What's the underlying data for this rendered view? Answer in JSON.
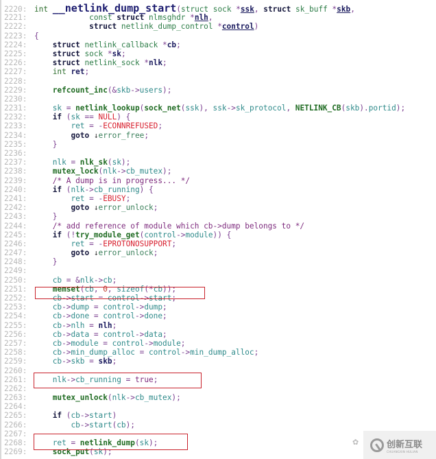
{
  "viewer": {
    "language": "C",
    "function_name": "__netlink_dump_start",
    "first_line": 2220,
    "last_line": 2269,
    "highlight_color": "#c8202a"
  },
  "lines": [
    {
      "n": "2220:",
      "tokens": [
        [
          "kwint",
          "int "
        ],
        [
          "fnbig",
          "__netlink_dump_start"
        ],
        [
          "punct",
          "("
        ],
        [
          "type",
          "struct sock "
        ],
        [
          "punct",
          "*"
        ],
        [
          "param",
          "ssk"
        ],
        [
          "punct",
          ", "
        ],
        [
          "kw",
          "struct "
        ],
        [
          "type",
          "sk_buff "
        ],
        [
          "punct",
          "*"
        ],
        [
          "param",
          "skb"
        ],
        [
          "punct",
          ","
        ]
      ]
    },
    {
      "n": "2221:",
      "tokens": [
        [
          "plain",
          "            "
        ],
        [
          "type",
          "const "
        ],
        [
          "kw",
          "struct "
        ],
        [
          "type",
          "nlmsghdr "
        ],
        [
          "punct",
          "*"
        ],
        [
          "param",
          "nlh"
        ],
        [
          "punct",
          ","
        ]
      ]
    },
    {
      "n": "2222:",
      "tokens": [
        [
          "plain",
          "            "
        ],
        [
          "kw",
          "struct "
        ],
        [
          "type",
          "netlink_dump_control "
        ],
        [
          "punct",
          "*"
        ],
        [
          "param",
          "control"
        ],
        [
          "punct",
          ")"
        ]
      ]
    },
    {
      "n": "2223:",
      "tokens": [
        [
          "punct",
          "{"
        ]
      ]
    },
    {
      "n": "2224:",
      "tokens": [
        [
          "plain",
          "    "
        ],
        [
          "kw",
          "struct "
        ],
        [
          "type",
          "netlink_callback "
        ],
        [
          "punct",
          "*"
        ],
        [
          "local",
          "cb"
        ],
        [
          "punct",
          ";"
        ]
      ]
    },
    {
      "n": "2225:",
      "tokens": [
        [
          "plain",
          "    "
        ],
        [
          "kw",
          "struct "
        ],
        [
          "type",
          "sock "
        ],
        [
          "punct",
          "*"
        ],
        [
          "local",
          "sk"
        ],
        [
          "punct",
          ";"
        ]
      ]
    },
    {
      "n": "2226:",
      "tokens": [
        [
          "plain",
          "    "
        ],
        [
          "kw",
          "struct "
        ],
        [
          "type",
          "netlink_sock "
        ],
        [
          "punct",
          "*"
        ],
        [
          "local",
          "nlk"
        ],
        [
          "punct",
          ";"
        ]
      ]
    },
    {
      "n": "2227:",
      "tokens": [
        [
          "plain",
          "    "
        ],
        [
          "kwint",
          "int "
        ],
        [
          "local",
          "ret"
        ],
        [
          "punct",
          ";"
        ]
      ]
    },
    {
      "n": "2228:",
      "tokens": []
    },
    {
      "n": "2229:",
      "tokens": [
        [
          "plain",
          "    "
        ],
        [
          "fn",
          "refcount_inc"
        ],
        [
          "punct",
          "(&"
        ],
        [
          "var",
          "skb"
        ],
        [
          "punct",
          "->"
        ],
        [
          "var",
          "users"
        ],
        [
          "punct",
          ");"
        ]
      ]
    },
    {
      "n": "2230:",
      "tokens": []
    },
    {
      "n": "2231:",
      "tokens": [
        [
          "plain",
          "    "
        ],
        [
          "var",
          "sk "
        ],
        [
          "punct",
          "= "
        ],
        [
          "fn",
          "netlink_lookup"
        ],
        [
          "punct",
          "("
        ],
        [
          "fn",
          "sock_net"
        ],
        [
          "punct",
          "("
        ],
        [
          "var",
          "ssk"
        ],
        [
          "punct",
          "), "
        ],
        [
          "var",
          "ssk"
        ],
        [
          "punct",
          "->"
        ],
        [
          "var",
          "sk_protocol"
        ],
        [
          "punct",
          ", "
        ],
        [
          "fn",
          "NETLINK_CB"
        ],
        [
          "punct",
          "("
        ],
        [
          "var",
          "skb"
        ],
        [
          "punct",
          ")."
        ],
        [
          "var",
          "portid"
        ],
        [
          "punct",
          ");"
        ]
      ]
    },
    {
      "n": "2232:",
      "tokens": [
        [
          "plain",
          "    "
        ],
        [
          "kw",
          "if "
        ],
        [
          "punct",
          "("
        ],
        [
          "var",
          "sk "
        ],
        [
          "punct",
          "== "
        ],
        [
          "const",
          "NULL"
        ],
        [
          "punct",
          ") {"
        ]
      ]
    },
    {
      "n": "2233:",
      "tokens": [
        [
          "plain",
          "        "
        ],
        [
          "var",
          "ret "
        ],
        [
          "punct",
          "= -"
        ],
        [
          "const",
          "ECONNREFUSED"
        ],
        [
          "punct",
          ";"
        ]
      ]
    },
    {
      "n": "2234:",
      "tokens": [
        [
          "plain",
          "        "
        ],
        [
          "kw",
          "goto "
        ],
        [
          "arrow",
          "↓"
        ],
        [
          "label",
          "error_free"
        ],
        [
          "punct",
          ";"
        ]
      ]
    },
    {
      "n": "2235:",
      "tokens": [
        [
          "plain",
          "    "
        ],
        [
          "punct",
          "}"
        ]
      ]
    },
    {
      "n": "2236:",
      "tokens": []
    },
    {
      "n": "2237:",
      "tokens": [
        [
          "plain",
          "    "
        ],
        [
          "var",
          "nlk "
        ],
        [
          "punct",
          "= "
        ],
        [
          "fn",
          "nlk_sk"
        ],
        [
          "punct",
          "("
        ],
        [
          "var",
          "sk"
        ],
        [
          "punct",
          ");"
        ]
      ]
    },
    {
      "n": "2238:",
      "tokens": [
        [
          "plain",
          "    "
        ],
        [
          "fn",
          "mutex_lock"
        ],
        [
          "punct",
          "("
        ],
        [
          "var",
          "nlk"
        ],
        [
          "punct",
          "->"
        ],
        [
          "var",
          "cb_mutex"
        ],
        [
          "punct",
          ");"
        ]
      ]
    },
    {
      "n": "2239:",
      "tokens": [
        [
          "plain",
          "    "
        ],
        [
          "comment",
          "/* A dump is in progress... */"
        ]
      ]
    },
    {
      "n": "2240:",
      "tokens": [
        [
          "plain",
          "    "
        ],
        [
          "kw",
          "if "
        ],
        [
          "punct",
          "("
        ],
        [
          "var",
          "nlk"
        ],
        [
          "punct",
          "->"
        ],
        [
          "var",
          "cb_running"
        ],
        [
          "punct",
          ") {"
        ]
      ]
    },
    {
      "n": "2241:",
      "tokens": [
        [
          "plain",
          "        "
        ],
        [
          "var",
          "ret "
        ],
        [
          "punct",
          "= -"
        ],
        [
          "const",
          "EBUSY"
        ],
        [
          "punct",
          ";"
        ]
      ]
    },
    {
      "n": "2242:",
      "tokens": [
        [
          "plain",
          "        "
        ],
        [
          "kw",
          "goto "
        ],
        [
          "arrow",
          "↓"
        ],
        [
          "label",
          "error_unlock"
        ],
        [
          "punct",
          ";"
        ]
      ]
    },
    {
      "n": "2243:",
      "tokens": [
        [
          "plain",
          "    "
        ],
        [
          "punct",
          "}"
        ]
      ]
    },
    {
      "n": "2244:",
      "tokens": [
        [
          "plain",
          "    "
        ],
        [
          "comment",
          "/* add reference of module which cb->dump belongs to */"
        ]
      ]
    },
    {
      "n": "2245:",
      "tokens": [
        [
          "plain",
          "    "
        ],
        [
          "kw",
          "if "
        ],
        [
          "punct",
          "(!"
        ],
        [
          "fn",
          "try_module_get"
        ],
        [
          "punct",
          "("
        ],
        [
          "var",
          "control"
        ],
        [
          "punct",
          "->"
        ],
        [
          "var",
          "module"
        ],
        [
          "punct",
          ")) {"
        ]
      ]
    },
    {
      "n": "2246:",
      "tokens": [
        [
          "plain",
          "        "
        ],
        [
          "var",
          "ret "
        ],
        [
          "punct",
          "= -"
        ],
        [
          "const",
          "EPROTONOSUPPORT"
        ],
        [
          "punct",
          ";"
        ]
      ]
    },
    {
      "n": "2247:",
      "tokens": [
        [
          "plain",
          "        "
        ],
        [
          "kw",
          "goto "
        ],
        [
          "arrow",
          "↓"
        ],
        [
          "label",
          "error_unlock"
        ],
        [
          "punct",
          ";"
        ]
      ]
    },
    {
      "n": "2248:",
      "tokens": [
        [
          "plain",
          "    "
        ],
        [
          "punct",
          "}"
        ]
      ]
    },
    {
      "n": "2249:",
      "tokens": []
    },
    {
      "n": "2250:",
      "tokens": [
        [
          "plain",
          "    "
        ],
        [
          "var",
          "cb "
        ],
        [
          "punct",
          "= &"
        ],
        [
          "var",
          "nlk"
        ],
        [
          "punct",
          "->"
        ],
        [
          "var",
          "cb"
        ],
        [
          "punct",
          ";"
        ]
      ]
    },
    {
      "n": "2251:",
      "tokens": [
        [
          "plain",
          "    "
        ],
        [
          "fn",
          "memset"
        ],
        [
          "punct",
          "("
        ],
        [
          "var",
          "cb"
        ],
        [
          "punct",
          ", "
        ],
        [
          "num",
          "0"
        ],
        [
          "punct",
          ", "
        ],
        [
          "var",
          "sizeof"
        ],
        [
          "punct",
          "(*"
        ],
        [
          "var",
          "cb"
        ],
        [
          "punct",
          "));"
        ]
      ]
    },
    {
      "n": "2252:",
      "tokens": [
        [
          "plain",
          "    "
        ],
        [
          "var",
          "cb"
        ],
        [
          "punct",
          "->"
        ],
        [
          "var",
          "start "
        ],
        [
          "punct",
          "= "
        ],
        [
          "var",
          "control"
        ],
        [
          "punct",
          "->"
        ],
        [
          "var",
          "start"
        ],
        [
          "punct",
          ";"
        ]
      ]
    },
    {
      "n": "2253:",
      "tokens": [
        [
          "plain",
          "    "
        ],
        [
          "var",
          "cb"
        ],
        [
          "punct",
          "->"
        ],
        [
          "var",
          "dump "
        ],
        [
          "punct",
          "= "
        ],
        [
          "var",
          "control"
        ],
        [
          "punct",
          "->"
        ],
        [
          "var",
          "dump"
        ],
        [
          "punct",
          ";"
        ]
      ]
    },
    {
      "n": "2254:",
      "tokens": [
        [
          "plain",
          "    "
        ],
        [
          "var",
          "cb"
        ],
        [
          "punct",
          "->"
        ],
        [
          "var",
          "done "
        ],
        [
          "punct",
          "= "
        ],
        [
          "var",
          "control"
        ],
        [
          "punct",
          "->"
        ],
        [
          "var",
          "done"
        ],
        [
          "punct",
          ";"
        ]
      ]
    },
    {
      "n": "2255:",
      "tokens": [
        [
          "plain",
          "    "
        ],
        [
          "var",
          "cb"
        ],
        [
          "punct",
          "->"
        ],
        [
          "var",
          "nlh "
        ],
        [
          "punct",
          "= "
        ],
        [
          "local",
          "nlh"
        ],
        [
          "punct",
          ";"
        ]
      ]
    },
    {
      "n": "2256:",
      "tokens": [
        [
          "plain",
          "    "
        ],
        [
          "var",
          "cb"
        ],
        [
          "punct",
          "->"
        ],
        [
          "var",
          "data "
        ],
        [
          "punct",
          "= "
        ],
        [
          "var",
          "control"
        ],
        [
          "punct",
          "->"
        ],
        [
          "var",
          "data"
        ],
        [
          "punct",
          ";"
        ]
      ]
    },
    {
      "n": "2257:",
      "tokens": [
        [
          "plain",
          "    "
        ],
        [
          "var",
          "cb"
        ],
        [
          "punct",
          "->"
        ],
        [
          "var",
          "module "
        ],
        [
          "punct",
          "= "
        ],
        [
          "var",
          "control"
        ],
        [
          "punct",
          "->"
        ],
        [
          "var",
          "module"
        ],
        [
          "punct",
          ";"
        ]
      ]
    },
    {
      "n": "2258:",
      "tokens": [
        [
          "plain",
          "    "
        ],
        [
          "var",
          "cb"
        ],
        [
          "punct",
          "->"
        ],
        [
          "var",
          "min_dump_alloc "
        ],
        [
          "punct",
          "= "
        ],
        [
          "var",
          "control"
        ],
        [
          "punct",
          "->"
        ],
        [
          "var",
          "min_dump_alloc"
        ],
        [
          "punct",
          ";"
        ]
      ]
    },
    {
      "n": "2259:",
      "tokens": [
        [
          "plain",
          "    "
        ],
        [
          "var",
          "cb"
        ],
        [
          "punct",
          "->"
        ],
        [
          "var",
          "skb "
        ],
        [
          "punct",
          "= "
        ],
        [
          "local",
          "skb"
        ],
        [
          "punct",
          ";"
        ]
      ]
    },
    {
      "n": "2260:",
      "tokens": []
    },
    {
      "n": "2261:",
      "tokens": [
        [
          "plain",
          "    "
        ],
        [
          "var",
          "nlk"
        ],
        [
          "punct",
          "->"
        ],
        [
          "var",
          "cb_running "
        ],
        [
          "punct",
          "= "
        ],
        [
          "comment",
          "true"
        ],
        [
          "punct",
          ";"
        ]
      ]
    },
    {
      "n": "2262:",
      "tokens": []
    },
    {
      "n": "2263:",
      "tokens": [
        [
          "plain",
          "    "
        ],
        [
          "fn",
          "mutex_unlock"
        ],
        [
          "punct",
          "("
        ],
        [
          "var",
          "nlk"
        ],
        [
          "punct",
          "->"
        ],
        [
          "var",
          "cb_mutex"
        ],
        [
          "punct",
          ");"
        ]
      ]
    },
    {
      "n": "2264:",
      "tokens": []
    },
    {
      "n": "2265:",
      "tokens": [
        [
          "plain",
          "    "
        ],
        [
          "kw",
          "if "
        ],
        [
          "punct",
          "("
        ],
        [
          "var",
          "cb"
        ],
        [
          "punct",
          "->"
        ],
        [
          "var",
          "start"
        ],
        [
          "punct",
          ")"
        ]
      ]
    },
    {
      "n": "2266:",
      "tokens": [
        [
          "plain",
          "        "
        ],
        [
          "var",
          "cb"
        ],
        [
          "punct",
          "->"
        ],
        [
          "var",
          "start"
        ],
        [
          "punct",
          "("
        ],
        [
          "var",
          "cb"
        ],
        [
          "punct",
          ");"
        ]
      ]
    },
    {
      "n": "2267:",
      "tokens": []
    },
    {
      "n": "2268:",
      "tokens": [
        [
          "plain",
          "    "
        ],
        [
          "var",
          "ret "
        ],
        [
          "punct",
          "= "
        ],
        [
          "fn",
          "netlink_dump"
        ],
        [
          "punct",
          "("
        ],
        [
          "var",
          "sk"
        ],
        [
          "punct",
          ");"
        ]
      ]
    },
    {
      "n": "2269:",
      "tokens": [
        [
          "plain",
          "    "
        ],
        [
          "fn",
          "sock_put"
        ],
        [
          "punct",
          "("
        ],
        [
          "var",
          "sk"
        ],
        [
          "punct",
          ");"
        ]
      ]
    }
  ],
  "highlights": [
    {
      "label": "memset-highlight",
      "from_line": "2251",
      "to_line": "2251"
    },
    {
      "label": "cb-running-highlight",
      "from_line": "2260",
      "to_line": "2261"
    },
    {
      "label": "netlink-dump-highlight",
      "from_line": "2267",
      "to_line": "2268"
    }
  ],
  "watermark": {
    "chinese": "创新互联",
    "english": "CHUANGXIN HULIAN",
    "icon": "wechat-icon"
  }
}
